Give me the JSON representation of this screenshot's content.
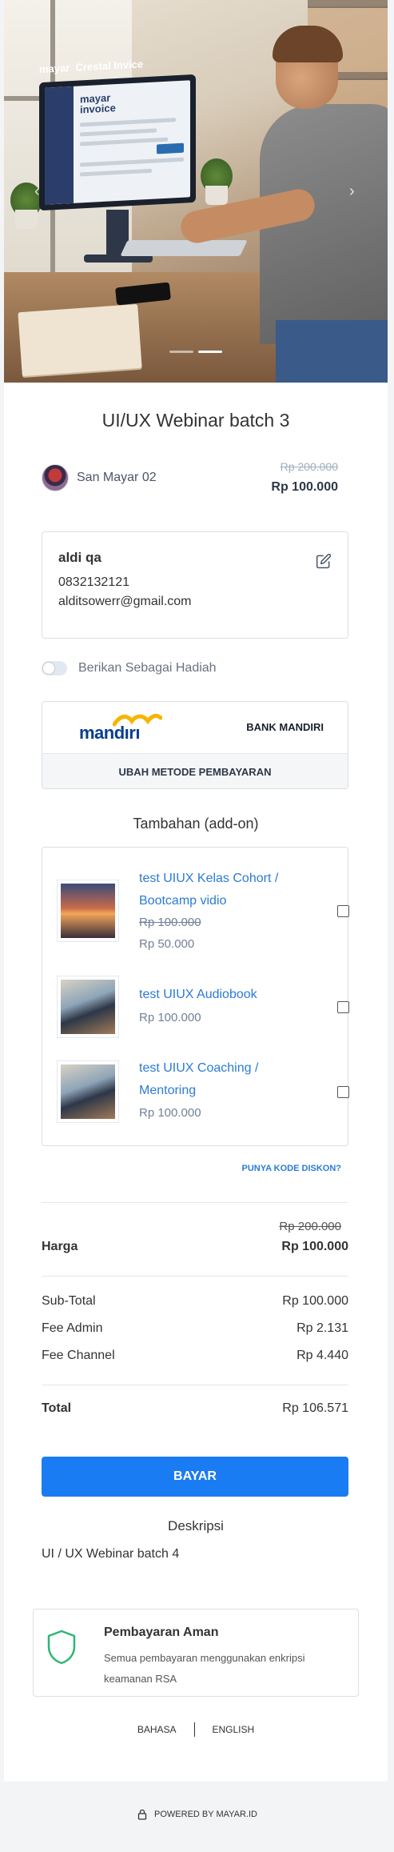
{
  "hero": {
    "screen_title": "Crestal Invice",
    "screen_brand": "mayar",
    "screen_logo_line1": "mayar",
    "screen_logo_line2": "invoice",
    "prev_icon": "chevron-left-icon",
    "next_icon": "chevron-right-icon",
    "slides_count": 2,
    "active_slide": 2
  },
  "product": {
    "title": "UI/UX Webinar batch 3",
    "seller_name": "San Mayar 02",
    "price_original": "Rp 200.000",
    "price_current": "Rp 100.000"
  },
  "buyer": {
    "name": "aldi qa",
    "phone": "0832132121",
    "email": "alditsowerr@gmail.com",
    "edit_icon": "edit-icon"
  },
  "gift": {
    "label": "Berikan Sebagai Hadiah",
    "enabled": false
  },
  "payment_method": {
    "logo_text": "mandırı",
    "bank_name": "BANK MANDIRI",
    "change_label": "UBAH METODE PEMBAYARAN"
  },
  "addons": {
    "title": "Tambahan (add-on)",
    "items": [
      {
        "name": "test UIUX Kelas Cohort / Bootcamp vidio",
        "price_original": "Rp 100.000",
        "price": "Rp 50.000",
        "checked": false
      },
      {
        "name": "test UIUX Audiobook",
        "price": "Rp 100.000",
        "checked": false
      },
      {
        "name": "test UIUX Coaching / Mentoring",
        "price": "Rp 100.000",
        "checked": false
      }
    ]
  },
  "discount_link": "PUNYA KODE DISKON?",
  "summary": {
    "harga_original": "Rp 200.000",
    "harga_label": "Harga",
    "harga_value": "Rp 100.000",
    "subtotal_label": "Sub-Total",
    "subtotal_value": "Rp 100.000",
    "fee_admin_label": "Fee Admin",
    "fee_admin_value": "Rp 2.131",
    "fee_channel_label": "Fee Channel",
    "fee_channel_value": "Rp 4.440",
    "total_label": "Total",
    "total_value": "Rp 106.571"
  },
  "pay_button": "BAYAR",
  "description": {
    "title": "Deskripsi",
    "text": "UI / UX Webinar batch 4"
  },
  "secure": {
    "title": "Pembayaran Aman",
    "text": "Semua pembayaran menggunakan enkripsi keamanan RSA",
    "icon": "shield-icon"
  },
  "language": {
    "option1": "BAHASA",
    "option2": "ENGLISH"
  },
  "footer": {
    "text": "POWERED BY MAYAR.ID",
    "icon": "lock-icon"
  },
  "colors": {
    "primary": "#1a7cf2",
    "link": "#2b7bd6",
    "mandiri_blue": "#0a3d8f",
    "mandiri_yellow": "#f7b500",
    "shield_green": "#2bb673"
  }
}
